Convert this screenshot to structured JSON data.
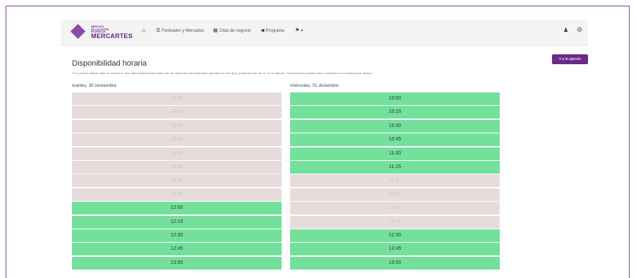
{
  "brand": {
    "small_lines": [
      "MERCADO",
      "DE LAS ARTES",
      "ESCÉNICAS"
    ],
    "name": "MERCARTES"
  },
  "nav": {
    "items": [
      {
        "label": "Festivales y Mercados",
        "icon": "list-icon"
      },
      {
        "label": "Citas de negocio",
        "icon": "calendar-icon"
      },
      {
        "label": "Programa",
        "icon": "megaphone-icon"
      }
    ]
  },
  "page": {
    "title": "Disponibilidad horaria",
    "agenda_button": "Ir a la agenda",
    "description": "Si no puedes atender citas de negocio en una determinada franja horaria, haz clic sobre ella para bloquearla (quedará en color gris), y después haz clic en \"Ir a la agenda\". Recuerda que puedes volver a activarla en el momento que desees."
  },
  "days": [
    {
      "title": "martes, 30 noviembre",
      "slots": [
        {
          "time": "10:00",
          "available": false
        },
        {
          "time": "10:15",
          "available": false
        },
        {
          "time": "10:30",
          "available": false
        },
        {
          "time": "10:45",
          "available": false
        },
        {
          "time": "11:00",
          "available": false
        },
        {
          "time": "11:15",
          "available": false
        },
        {
          "time": "11:30",
          "available": false
        },
        {
          "time": "11:45",
          "available": false
        },
        {
          "time": "12:00",
          "available": true
        },
        {
          "time": "12:15",
          "available": true
        },
        {
          "time": "12:30",
          "available": true
        },
        {
          "time": "12:45",
          "available": true
        },
        {
          "time": "13:00",
          "available": true
        }
      ]
    },
    {
      "title": "miércoles, 01 diciembre",
      "slots": [
        {
          "time": "10:00",
          "available": true
        },
        {
          "time": "10:15",
          "available": true
        },
        {
          "time": "10:30",
          "available": true
        },
        {
          "time": "10:45",
          "available": true
        },
        {
          "time": "11:00",
          "available": true
        },
        {
          "time": "11:15",
          "available": true
        },
        {
          "time": "11:30",
          "available": false
        },
        {
          "time": "11:45",
          "available": false
        },
        {
          "time": "12:00",
          "available": false
        },
        {
          "time": "12:15",
          "available": false
        },
        {
          "time": "12:30",
          "available": true
        },
        {
          "time": "12:45",
          "available": true
        },
        {
          "time": "13:00",
          "available": true
        }
      ]
    }
  ],
  "colors": {
    "brand_purple": "#6a2a86",
    "available": "#73e09c",
    "unavailable": "#e7dcdc"
  }
}
